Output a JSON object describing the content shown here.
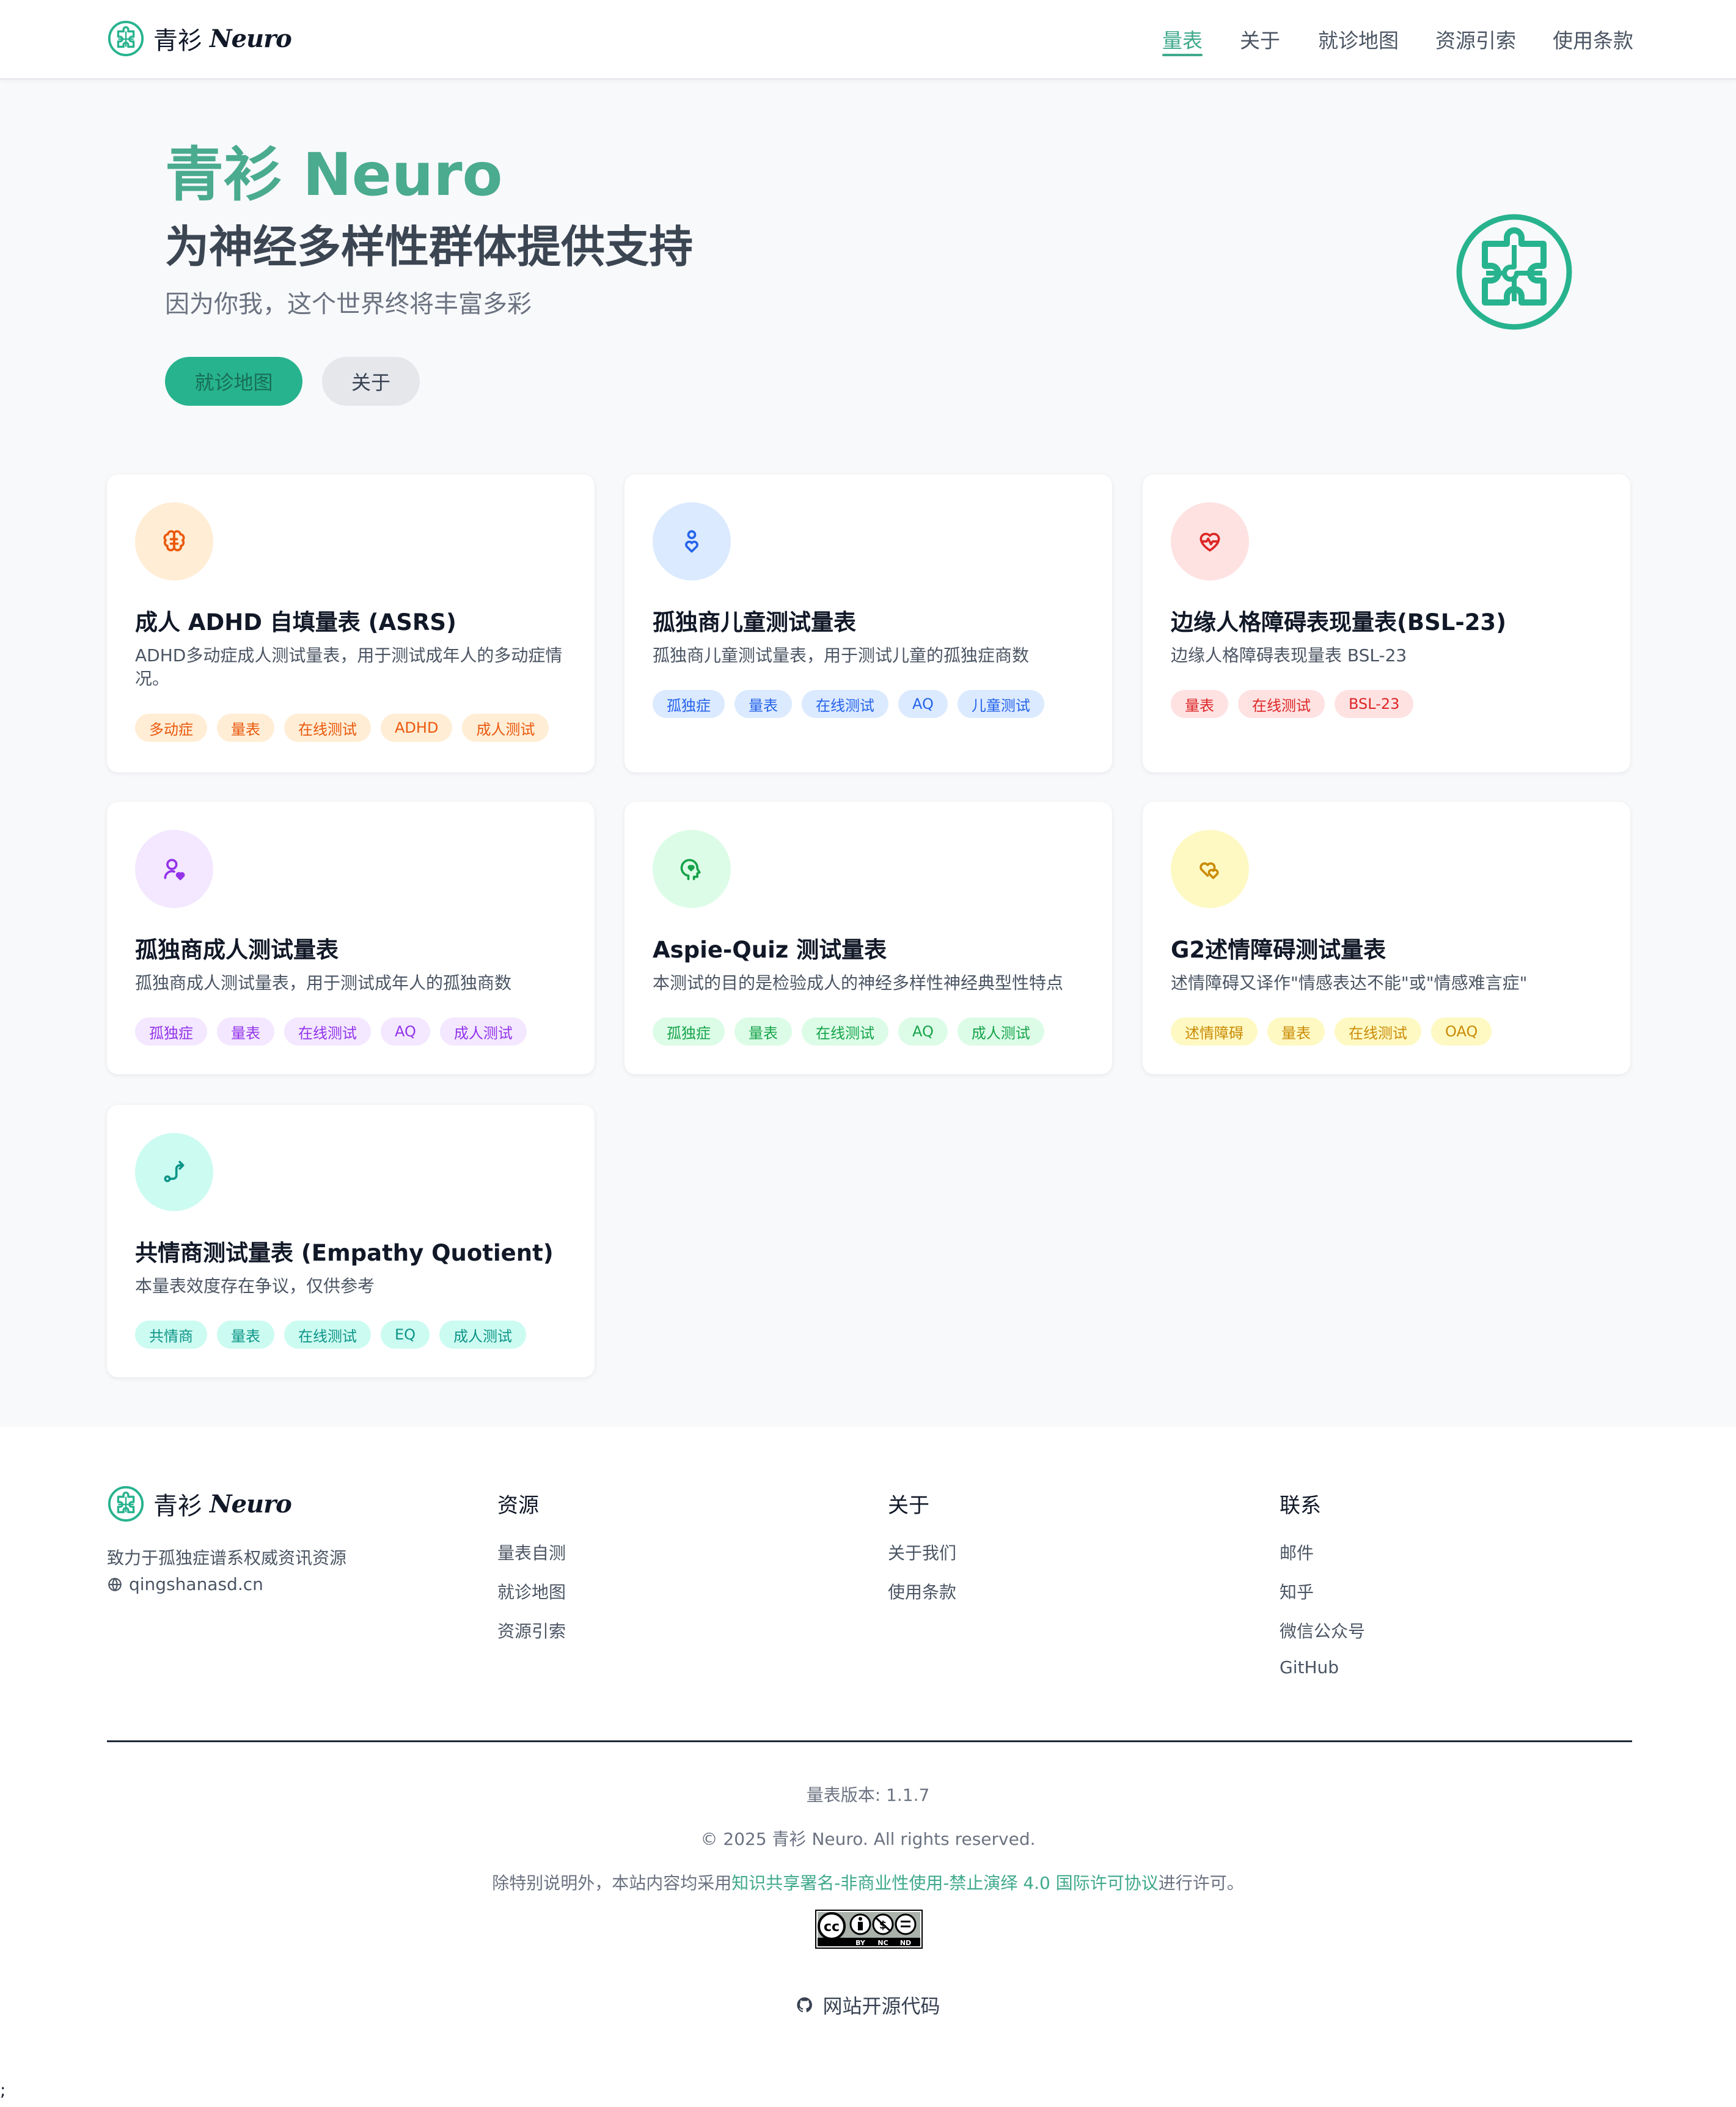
{
  "header": {
    "brand_cn": "青衫",
    "brand_en": "Neuro",
    "nav": [
      {
        "label": "量表",
        "active": true
      },
      {
        "label": "关于"
      },
      {
        "label": "就诊地图"
      },
      {
        "label": "资源引索"
      },
      {
        "label": "使用条款"
      }
    ]
  },
  "hero": {
    "title": "青衫 Neuro",
    "subtitle": "为神经多样性群体提供支持",
    "tagline": "因为你我，这个世界终将丰富多彩",
    "primary_button": "就诊地图",
    "secondary_button": "关于",
    "icon": "puzzle-icon"
  },
  "cards": [
    {
      "title": "成人 ADHD 自填量表 (ASRS)",
      "desc": "ADHD多动症成人测试量表，用于测试成年人的多动症情况。",
      "icon": "brain-icon",
      "color": "#ea580c",
      "bg": "#ffedd5",
      "tag_bg": "#ffedd5",
      "tags": [
        "多动症",
        "量表",
        "在线测试",
        "ADHD",
        "成人测试"
      ]
    },
    {
      "title": "孤独商儿童测试量表",
      "desc": "孤独商儿童测试量表，用于测试儿童的孤独症商数",
      "icon": "child-icon",
      "color": "#2563eb",
      "bg": "#dbeafe",
      "tag_bg": "#dbeafe",
      "tags": [
        "孤独症",
        "量表",
        "在线测试",
        "AQ",
        "儿童测试"
      ]
    },
    {
      "title": "边缘人格障碍表现量表(BSL-23)",
      "desc": "边缘人格障碍表现量表 BSL-23",
      "icon": "heart-pulse-icon",
      "color": "#dc2626",
      "bg": "#fee2e2",
      "tag_bg": "#fee2e2",
      "tags": [
        "量表",
        "在线测试",
        "BSL-23"
      ]
    },
    {
      "title": "孤独商成人测试量表",
      "desc": "孤独商成人测试量表，用于测试成年人的孤独商数",
      "icon": "user-heart-icon",
      "color": "#9333ea",
      "bg": "#f3e8ff",
      "tag_bg": "#f3e8ff",
      "tags": [
        "孤独症",
        "量表",
        "在线测试",
        "AQ",
        "成人测试"
      ]
    },
    {
      "title": "Aspie-Quiz 测试量表",
      "desc": "本测试的目的是检验成人的神经多样性神经典型性特点",
      "icon": "head-heart-icon",
      "color": "#16a34a",
      "bg": "#dcfce7",
      "tag_bg": "#dcfce7",
      "tags": [
        "孤独症",
        "量表",
        "在线测试",
        "AQ",
        "成人测试"
      ]
    },
    {
      "title": "G2述情障碍测试量表",
      "desc": "述情障碍又译作\"情感表达不能\"或\"情感难言症\"",
      "icon": "hearts-icon",
      "color": "#ca8a04",
      "bg": "#fef9c3",
      "tag_bg": "#fef9c3",
      "tags": [
        "述情障碍",
        "量表",
        "在线测试",
        "OAQ"
      ]
    },
    {
      "title": "共情商测试量表 (Empathy Quotient)",
      "desc": "本量表效度存在争议，仅供参考",
      "icon": "route-icon",
      "color": "#0d9488",
      "bg": "#ccfbf1",
      "tag_bg": "#ccfbf1",
      "tags": [
        "共情商",
        "量表",
        "在线测试",
        "EQ",
        "成人测试"
      ]
    }
  ],
  "footer": {
    "brand_cn": "青衫",
    "brand_en": "Neuro",
    "desc": "致力于孤独症谱系权威资讯资源",
    "site": "qingshanasd.cn",
    "columns": [
      {
        "title": "资源",
        "links": [
          "量表自测",
          "就诊地图",
          "资源引索"
        ]
      },
      {
        "title": "关于",
        "links": [
          "关于我们",
          "使用条款"
        ]
      },
      {
        "title": "联系",
        "links": [
          "邮件",
          "知乎",
          "微信公众号",
          "GitHub"
        ]
      }
    ],
    "version": "量表版本: 1.1.7",
    "copyright": "© 2025 青衫 Neuro. All rights reserved.",
    "license_prefix": "除特别说明外，本站内容均采用",
    "license_link": "知识共享署名-非商业性使用-禁止演绎 4.0 国际许可协议",
    "license_suffix": "进行许可。",
    "cc_badge": [
      "BY",
      "NC",
      "ND"
    ],
    "source_link": "网站开源代码",
    "stray": ";"
  }
}
